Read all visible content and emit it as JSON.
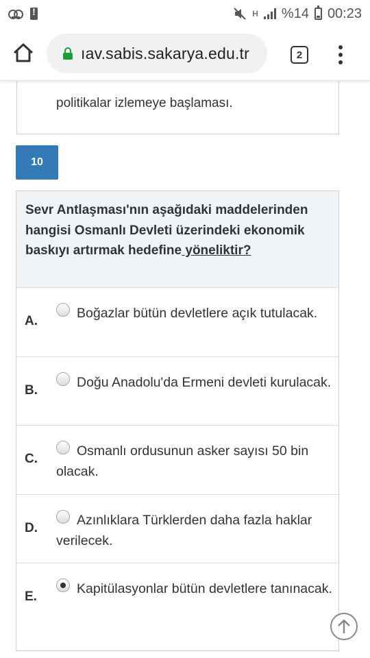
{
  "status_bar": {
    "network_label": "H",
    "battery_text": "%14",
    "time": "00:23"
  },
  "browser": {
    "url": "ıav.sabis.sakarya.edu.tr",
    "tab_count": "2"
  },
  "previous_question": {
    "option_tail": "politikalar izlemeye başlaması."
  },
  "question": {
    "number": "10",
    "text_part1": "Sevr Antlaşması'nın aşağıdaki maddelerinden hangisi Osmanlı Devleti üzerindeki ekonomik baskıyı artırmak hedefine",
    "text_underlined": " yöneliktir?",
    "options": [
      {
        "letter": "A.",
        "text": "Boğazlar bütün devletlere açık tutulacak.",
        "selected": false
      },
      {
        "letter": "B.",
        "text": "Doğu Anadolu'da Ermeni devleti kurulacak.",
        "selected": false
      },
      {
        "letter": "C.",
        "text": "Osmanlı ordusunun asker sayısı 50 bin olacak.",
        "selected": false
      },
      {
        "letter": "D.",
        "text": "Azınlıklara Türklerden daha fazla haklar verilecek.",
        "selected": false
      },
      {
        "letter": "E.",
        "text": "Kapitülasyonlar bütün devletlere tanınacak.",
        "selected": true
      }
    ]
  },
  "colors": {
    "badge": "#337ab7",
    "lock": "#1a9e3a",
    "question_header_bg": "#f1f4f7"
  },
  "icons": [
    "voicemail-icon",
    "alert-icon",
    "mute-icon",
    "signal-icon",
    "battery-icon",
    "home-icon",
    "lock-icon",
    "tabs-icon",
    "menu-icon",
    "scroll-top-icon"
  ]
}
